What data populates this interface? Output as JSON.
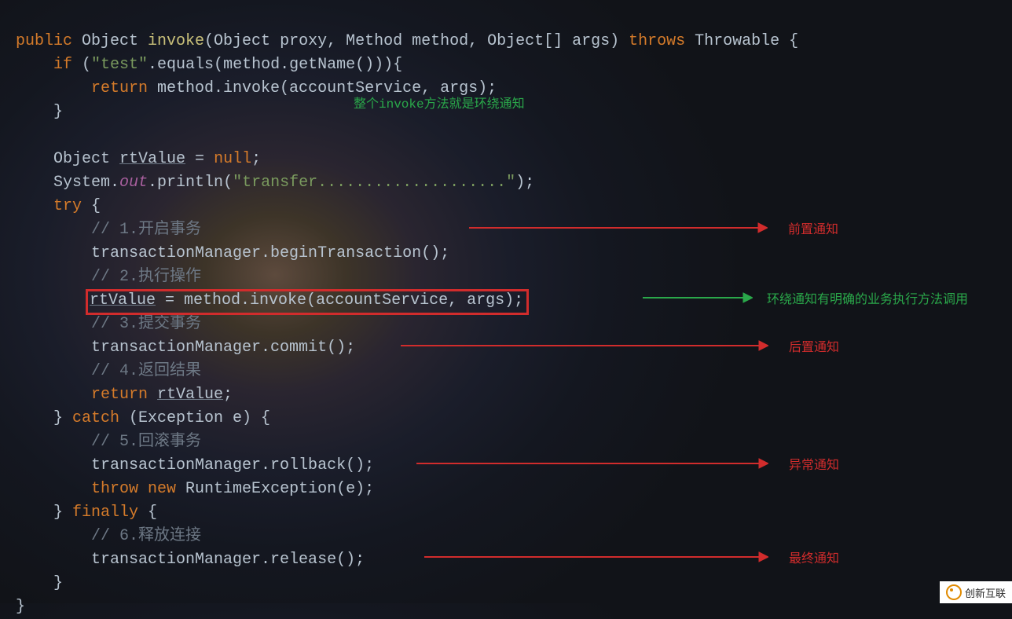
{
  "code": {
    "l1_public": "public",
    "l1_sig": " Object ",
    "l1_fn": "invoke",
    "l1_params": "(Object proxy, Method method, Object[] args) ",
    "l1_throws": "throws",
    "l1_t2": " Throwable {",
    "l2_if": "    if ",
    "l2_str": "\"test\"",
    "l2_rest": ".equals(method.getName())){",
    "l3_ret": "        return ",
    "l3_rest": "method.invoke(accountService, args);",
    "l4": "    }",
    "l6a": "    Object ",
    "l6_rt": "rtValue",
    "l6b": " = ",
    "l6_null": "null",
    "l6c": ";",
    "l7a": "    System.",
    "l7_out": "out",
    "l7b": ".println(",
    "l7_str": "\"transfer....................\"",
    "l7c": ");",
    "l8_try": "    try ",
    "l8b": "{",
    "l9_c": "        // 1.开启事务",
    "l10": "        transactionManager.beginTransaction();",
    "l11_c": "        // 2.执行操作",
    "l12a": "        ",
    "l12_rt": "rtValue",
    "l12b": " = method.invoke(accountService, args);",
    "l13_c": "        // 3.提交事务",
    "l14": "        transactionManager.commit();",
    "l15_c": "        // 4.返回结果",
    "l16_ret": "        return ",
    "l16_rt": "rtValue",
    "l16b": ";",
    "l17a": "    } ",
    "l17_catch": "catch ",
    "l17b": "(Exception e) {",
    "l18_c": "        // 5.回滚事务",
    "l19": "        transactionManager.rollback();",
    "l20_throw": "        throw new ",
    "l20b": "RuntimeException(e);",
    "l21a": "    } ",
    "l21_fin": "finally ",
    "l21b": "{",
    "l22_c": "        // 6.释放连接",
    "l23": "        transactionManager.release();",
    "l24": "    }",
    "l25": "}"
  },
  "annotations": {
    "around_title": "整个invoke方法就是环绕通知",
    "before": "前置通知",
    "around_call": "环绕通知有明确的业务执行方法调用",
    "after_returning": "后置通知",
    "after_throwing": "异常通知",
    "after": "最终通知"
  },
  "watermark": "创新互联"
}
